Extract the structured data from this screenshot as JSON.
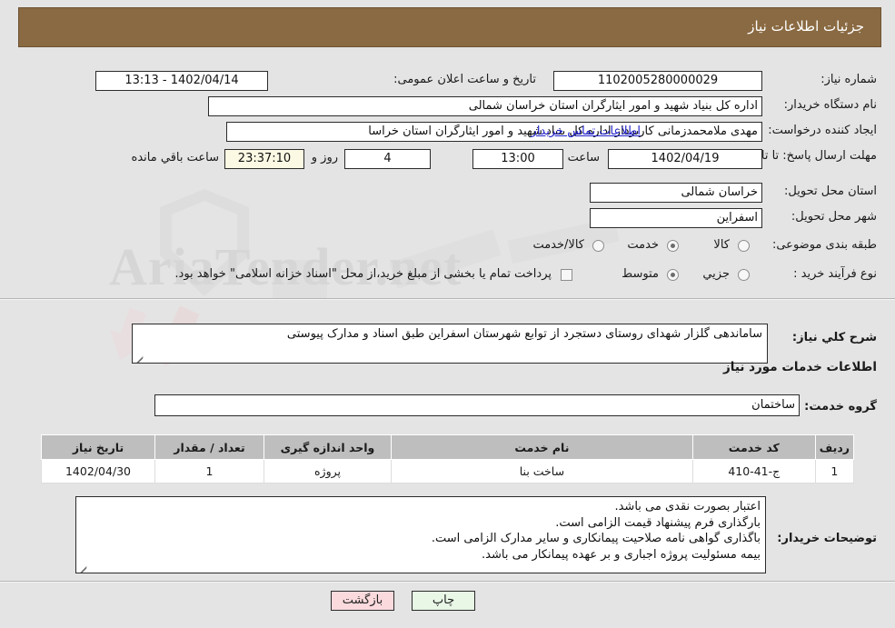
{
  "header": {
    "title": "جزئیات اطلاعات نیاز"
  },
  "fields": {
    "need_number_label": "شماره نیاز:",
    "need_number_value": "1102005280000029",
    "announce_label": "تاریخ و ساعت اعلان عمومی:",
    "announce_value": "1402/04/14 - 13:13",
    "buyer_org_label": "نام دستگاه خریدار:",
    "buyer_org_value": "اداره کل بنیاد شهید و امور ایثارگران استان خراسان شمالی",
    "creator_label": "ایجاد کننده درخواست:",
    "creator_value": "مهدی  ملامحمدزمانی کاربرداز اداره کل بنیاد شهید و امور ایثارگران استان خراسا",
    "contact_link": "اطلاعات تماس خریدار",
    "deadline_label": "مهلت ارسال پاسخ: تا تاریخ:",
    "deadline_date": "1402/04/19",
    "hour_label": "ساعت",
    "hour_value": "13:00",
    "days_value": "4",
    "days_and_label": "روز و",
    "countdown_value": "23:37:10",
    "remaining_label": "ساعت باقي مانده",
    "province_label": "استان محل تحویل:",
    "province_value": "خراسان شمالی",
    "city_label": "شهر محل تحویل:",
    "city_value": "اسفراین",
    "category_label": "طبقه بندی موضوعی:",
    "process_label": "نوع فرآیند خرید :",
    "payment_note": "پرداخت تمام یا بخشی از مبلغ خرید،از محل \"اسناد خزانه اسلامی\" خواهد بود."
  },
  "category_options": [
    {
      "label": "کالا",
      "selected": false
    },
    {
      "label": "خدمت",
      "selected": true
    },
    {
      "label": "کالا/خدمت",
      "selected": false
    }
  ],
  "process_options": [
    {
      "label": "جزیي",
      "selected": false
    },
    {
      "label": "متوسط",
      "selected": true
    }
  ],
  "summary": {
    "label": "شرح کلي نیاز:",
    "value": "ساماندهی گلزار شهدای روستای دستجرد از توابع شهرستان اسفراین طبق اسناد و مدارک پیوستی"
  },
  "services_section": {
    "heading": "اطلاعات خدمات مورد نیاز",
    "group_label": "گروه خدمت:",
    "group_value": "ساختمان"
  },
  "table": {
    "columns": [
      "ردیف",
      "کد خدمت",
      "نام خدمت",
      "واحد اندازه گیری",
      "تعداد / مقدار",
      "تاریخ نیاز"
    ],
    "rows": [
      {
        "row_no": "1",
        "service_code": "ج-41-410",
        "service_name": "ساخت بنا",
        "unit": "پروژه",
        "quantity": "1",
        "need_date": "1402/04/30"
      }
    ]
  },
  "notes": {
    "label": "توضیحات خریدار:",
    "lines": [
      "اعتبار بصورت نقدی می باشد.",
      "بارگذاری فرم پیشنهاد قیمت الزامی است.",
      "باگذاری گواهی نامه صلاحیت پیمانکاری و سایر مدارک الزامی است.",
      "بیمه مسئولیت پروژه اجباری و بر عهده پیمانکار می باشد."
    ]
  },
  "buttons": {
    "print": "چاپ",
    "back": "بازگشت"
  },
  "watermark": {
    "text": "AriaTender.net"
  },
  "colors": {
    "header_bg": "#8a6a42",
    "page_bg": "#e4e4e4",
    "link": "#2222cc",
    "table_header_bg": "#bebebe",
    "print_btn": "#e8f7e6",
    "back_btn": "#fadadd",
    "countdown_bg": "#fbf8e3"
  }
}
